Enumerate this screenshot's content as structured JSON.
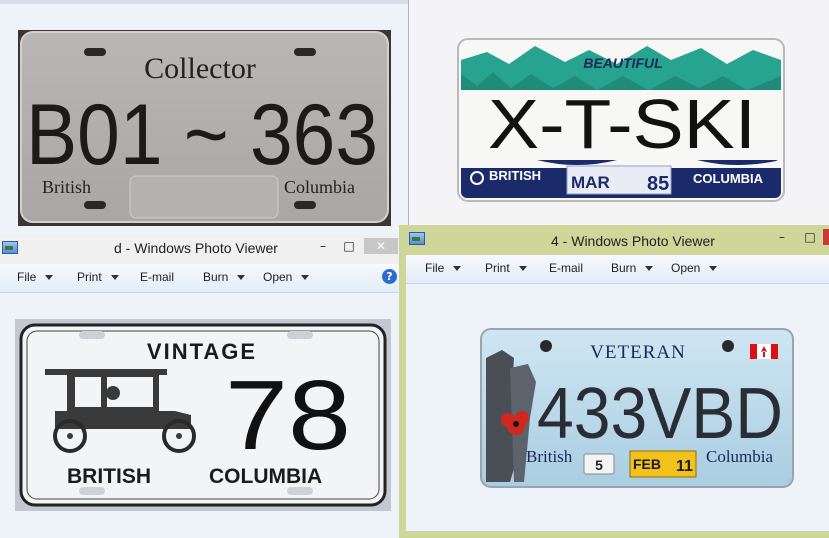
{
  "plates": {
    "collector": {
      "top": "Collector",
      "number": "B01 ~ 363",
      "left": "British",
      "right": "Columbia"
    },
    "ski": {
      "top": "BEAUTIFUL",
      "number": "X-T-SKI",
      "left": "BRITISH",
      "month": "MAR",
      "year": "85",
      "right": "COLUMBIA"
    },
    "vintage": {
      "top": "VINTAGE",
      "number": "78",
      "left": "BRITISH",
      "right": "COLUMBIA"
    },
    "veteran": {
      "top": "VETERAN",
      "number": "433VBD",
      "left": "British",
      "sticker_num": "5",
      "month": "FEB",
      "year": "11",
      "right": "Columbia"
    }
  },
  "windows": {
    "left": {
      "title": "d - Windows Photo Viewer",
      "menu": {
        "file": "File",
        "print": "Print",
        "email": "E-mail",
        "burn": "Burn",
        "open": "Open"
      },
      "help": "?",
      "controls": {
        "minimize": "–",
        "maximize": "□",
        "close": "✕"
      }
    },
    "right": {
      "title": "4 - Windows Photo Viewer",
      "menu": {
        "file": "File",
        "print": "Print",
        "email": "E-mail",
        "burn": "Burn",
        "open": "Open"
      },
      "controls": {
        "minimize": "–",
        "maximize": "□",
        "close": ""
      }
    }
  },
  "colors": {
    "titlebar_inactive": "#f0f0f0",
    "titlebar_active": "#cfd69a",
    "client": "#eef3fa"
  }
}
